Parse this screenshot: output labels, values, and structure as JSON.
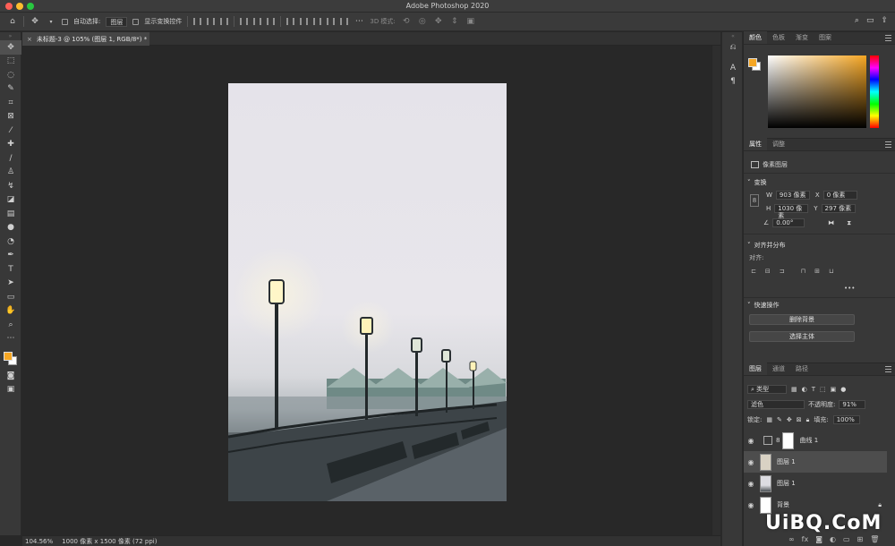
{
  "window": {
    "title": "Adobe Photoshop 2020"
  },
  "options_bar": {
    "auto_select_label": "自动选择:",
    "auto_select_value": "图层",
    "show_transform_label": "显示变换控件",
    "mode_3d_label": "3D 模式:"
  },
  "document": {
    "tab_title": "未标题-3 @ 105% (图层 1, RGB/8*) *",
    "close_glyph": "×"
  },
  "status": {
    "zoom": "104.56%",
    "doc_size": "1000 像素 x 1500 像素 (72 ppi)"
  },
  "color_panel": {
    "tabs": [
      "颜色",
      "色板",
      "渐变",
      "图案"
    ],
    "foreground_color": "#f5a623",
    "background_color": "#ffffff"
  },
  "properties_panel": {
    "tabs": [
      "属性",
      "调整"
    ],
    "type_label": "像素图层",
    "transform_heading": "变换",
    "w_label": "W",
    "w_value": "903 像素",
    "h_label": "H",
    "h_value": "1030 像素",
    "x_label": "X",
    "x_value": "0 像素",
    "y_label": "Y",
    "y_value": "297 像素",
    "angle_value": "0.00°",
    "align_heading": "对齐并分布",
    "align_label": "对齐:",
    "more_glyph": "•••",
    "quick_actions_heading": "快速操作",
    "remove_bg_button": "删除背景",
    "select_subject_button": "选择主体"
  },
  "layers_panel": {
    "tabs": [
      "图层",
      "通道",
      "路径"
    ],
    "filter_label": "类型",
    "blend_mode": "滤色",
    "opacity_label": "不透明度:",
    "opacity_value": "91%",
    "lock_label": "锁定:",
    "fill_label": "填充:",
    "fill_value": "100%",
    "layers": [
      {
        "name": "曲线 1"
      },
      {
        "name": "图层 1"
      },
      {
        "name": "图层 1"
      },
      {
        "name": "背景"
      }
    ]
  },
  "watermark": {
    "text": "UiBQ.CoM"
  }
}
